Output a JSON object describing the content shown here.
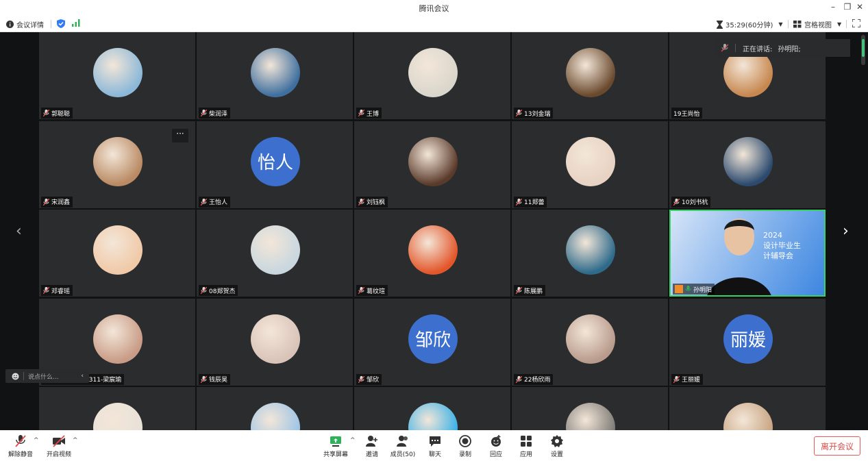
{
  "window": {
    "title": "腾讯会议",
    "minimize_icon": "minimize-icon",
    "restore_icon": "restore-icon",
    "close_icon": "close-icon"
  },
  "infobar": {
    "meeting_details": "会议详情",
    "timer": "35:29(60分钟)",
    "view_mode": "宫格视图",
    "colors": {
      "shield": "#2f7cf6",
      "signal": "#31b25a"
    }
  },
  "stage": {
    "speaking_label": "正在讲话:",
    "speaking_name": "孙明阳;",
    "chat_placeholder": "说点什么...",
    "active_border": "#3cd06a"
  },
  "participants": [
    {
      "name": "郭聪聪",
      "avatar_text": "",
      "muted": true
    },
    {
      "name": "柴润泽",
      "avatar_text": "",
      "muted": true
    },
    {
      "name": "王博",
      "avatar_text": "",
      "muted": true
    },
    {
      "name": "13刘金瑞",
      "avatar_text": "",
      "muted": true
    },
    {
      "name": "19王尚怡",
      "avatar_text": "",
      "muted": false
    },
    {
      "name": "宋润鑫",
      "avatar_text": "",
      "muted": true
    },
    {
      "name": "王怡人",
      "avatar_text": "怡人",
      "muted": true
    },
    {
      "name": "刘钰枫",
      "avatar_text": "",
      "muted": true
    },
    {
      "name": "11郑蕾",
      "avatar_text": "",
      "muted": true
    },
    {
      "name": "10刘书杭",
      "avatar_text": "",
      "muted": true
    },
    {
      "name": "邓睿瑶",
      "avatar_text": "",
      "muted": true
    },
    {
      "name": "08郑贺杰",
      "avatar_text": "",
      "muted": true
    },
    {
      "name": "葛纹瑄",
      "avatar_text": "",
      "muted": true
    },
    {
      "name": "陈展鹏",
      "avatar_text": "",
      "muted": true
    },
    {
      "name": "孙明阳",
      "avatar_text": "",
      "muted": false,
      "video": true,
      "video_text": [
        "2024",
        "设计毕业生",
        "计辅导会"
      ]
    },
    {
      "name": "05-2023049311-梁宸瑜",
      "avatar_text": "",
      "muted": true
    },
    {
      "name": "钱辰昊",
      "avatar_text": "",
      "muted": true
    },
    {
      "name": "邹欣",
      "avatar_text": "邹欣",
      "muted": true
    },
    {
      "name": "22杨欣雨",
      "avatar_text": "",
      "muted": true
    },
    {
      "name": "王丽媛",
      "avatar_text": "丽媛",
      "muted": true
    },
    {
      "name": "",
      "avatar_text": "",
      "muted": true
    },
    {
      "name": "",
      "avatar_text": "",
      "muted": true
    },
    {
      "name": "",
      "avatar_text": "",
      "muted": true
    },
    {
      "name": "",
      "avatar_text": "",
      "muted": true
    },
    {
      "name": "",
      "avatar_text": "",
      "muted": true
    }
  ],
  "toolbar": {
    "unmute": "解除静音",
    "start_video": "开启视频",
    "share_screen": "共享屏幕",
    "invite": "邀请",
    "members": "成员(50)",
    "chat": "聊天",
    "record": "录制",
    "react": "回应",
    "apps": "应用",
    "settings": "设置",
    "leave": "离开会议"
  }
}
